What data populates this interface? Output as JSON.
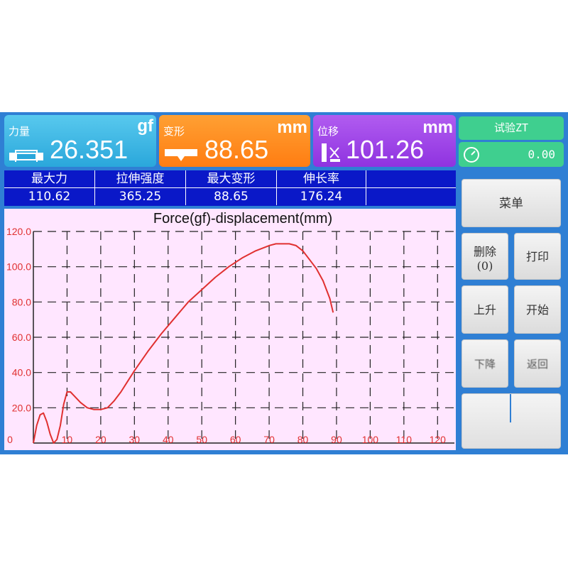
{
  "cards": {
    "force": {
      "label": "力量",
      "value": "26.351",
      "unit": "gf",
      "icon": "clamp-icon"
    },
    "deformation": {
      "label": "变形",
      "value": "88.65",
      "unit": "mm",
      "icon": "deformation-icon"
    },
    "displacement": {
      "label": "位移",
      "value": "101.26",
      "unit": "mm",
      "icon": "displacement-icon"
    }
  },
  "test_panel": {
    "label": "试验ZT",
    "timer": "0.00",
    "timer_icon": "gauge-icon"
  },
  "stats": {
    "headers": [
      "最大力",
      "拉伸强度",
      "最大变形",
      "伸长率",
      ""
    ],
    "values": [
      "110.62",
      "365.25",
      "88.65",
      "176.24",
      ""
    ]
  },
  "buttons": {
    "menu": "菜单",
    "delete_line1": "删除",
    "delete_line2": "(0)",
    "print": "打印",
    "up": "上升",
    "start": "开始",
    "down": "下降",
    "return": "返回"
  },
  "colors": {
    "curve": "#e03030",
    "axis_text": "#e03030",
    "chart_bg": "#ffe6ff",
    "stats_bg": "#0a18c8"
  },
  "chart_data": {
    "type": "line",
    "title": "Force(gf)-displacement(mm)",
    "xlabel": "",
    "ylabel": "",
    "xlim": [
      0,
      125
    ],
    "ylim": [
      0,
      120
    ],
    "xticks": [
      0,
      10,
      20,
      30,
      40,
      50,
      60,
      70,
      80,
      90,
      100,
      110,
      120
    ],
    "yticks": [
      0,
      20,
      40,
      60,
      80,
      100,
      120
    ],
    "x_tick_labels": [
      "0",
      "10",
      "20",
      "30",
      "40",
      "50",
      "60",
      "70",
      "80",
      "90",
      "100",
      "110",
      "120"
    ],
    "y_tick_labels": [
      "0",
      "20.0",
      "40.0",
      "60.0",
      "80.0",
      "100.0",
      "120.0"
    ],
    "grid": true,
    "series": [
      {
        "x": [
          0,
          1,
          2,
          3,
          4,
          5,
          6,
          7,
          8,
          9,
          10,
          11,
          12,
          14,
          16,
          18,
          20,
          22,
          24,
          26,
          28,
          30,
          34,
          38,
          42,
          46,
          50,
          54,
          58,
          62,
          66,
          70,
          72,
          74,
          76,
          78,
          80,
          82,
          84,
          86,
          88,
          89
        ],
        "y": [
          0,
          10,
          16,
          17,
          12,
          5,
          0,
          2,
          10,
          22,
          29,
          29,
          27,
          23,
          20,
          19,
          19,
          20,
          24,
          29,
          35,
          41,
          52,
          62,
          71,
          80,
          87,
          94,
          100,
          105,
          109,
          112,
          113,
          113,
          113,
          112,
          109,
          104,
          99,
          92,
          82,
          74
        ]
      }
    ]
  }
}
